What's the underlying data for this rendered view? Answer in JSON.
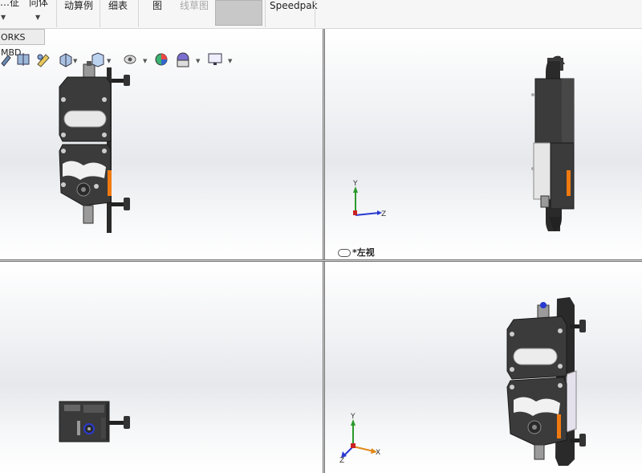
{
  "toolbar": {
    "item_truncated1": "…征",
    "item_truncated2": "向体",
    "item_animation": "动算例",
    "item_bom": "细表",
    "item_drawing": "图",
    "item_sketch": "线草图",
    "item_speedpak": "Speedpak"
  },
  "tabs": {
    "mbd": "ORKS MBD"
  },
  "heads_up_toolbar": {
    "icons": [
      "view-orientation-icon",
      "section-view-icon",
      "dynamic-annotation-icon",
      "display-style-icon",
      "hide-show-icon",
      "edit-appearance-icon",
      "apply-scene-icon",
      "view-settings-icon"
    ]
  },
  "viewports": {
    "top_right": {
      "label": "*左视"
    }
  },
  "triad": {
    "axis_y": "Y",
    "axis_z": "Z",
    "axis_x": "X",
    "colors": {
      "y": "#2a9a2a",
      "z": "#2a3ad0",
      "x": "#e08a1a"
    }
  },
  "colors": {
    "accent_part": "#f07a10",
    "body": "#3a3a3a"
  }
}
